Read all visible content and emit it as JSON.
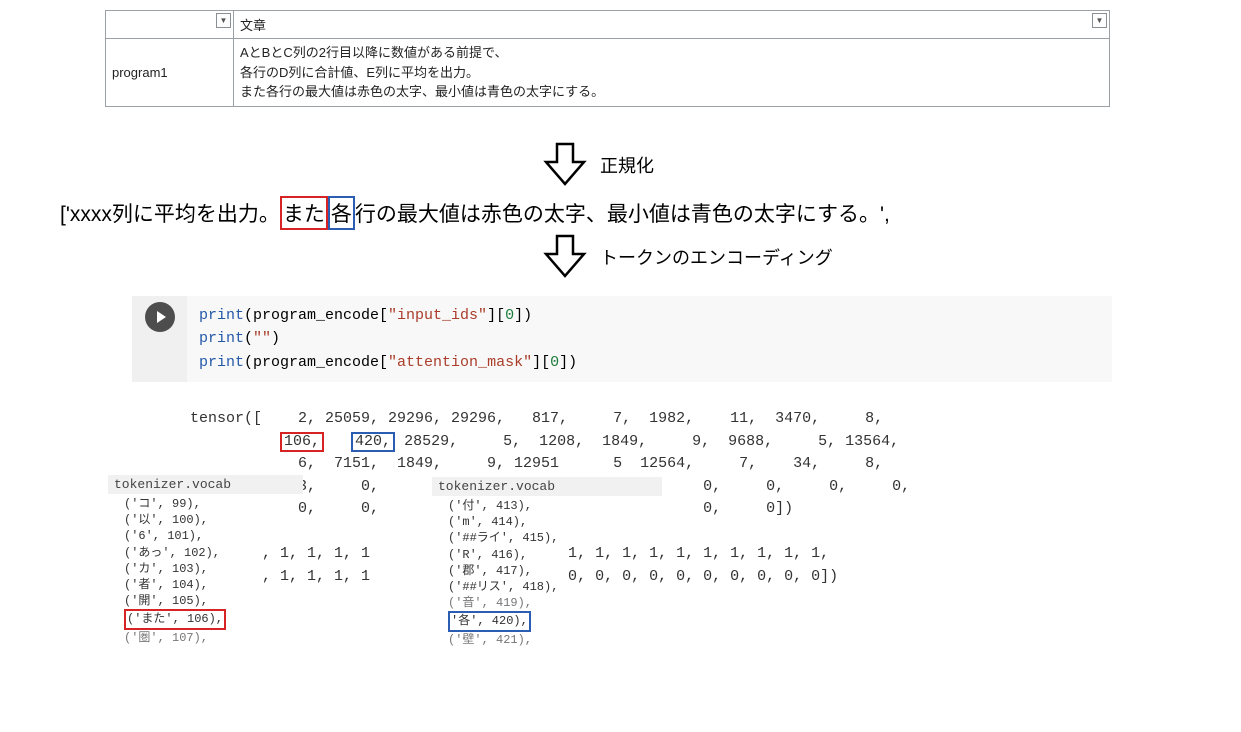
{
  "table": {
    "header_right": "文章",
    "row1_left": "program1",
    "row1_line1": "AとBとC列の2行目以降に数値がある前提で、",
    "row1_line2": "各行のD列に合計値、E列に平均を出力。",
    "row1_line3": "また各行の最大値は赤色の太字、最小値は青色の太字にする。"
  },
  "arrows": {
    "label1": "正規化",
    "label2": "トークンのエンコーディング"
  },
  "norm": {
    "prefix": "['xxxx列に平均を出力。",
    "red": "また",
    "blue": "各",
    "suffix": "行の最大値は赤色の太字、最小値は青色の太字にする。',"
  },
  "code": {
    "line1_a": "print",
    "line1_b": "(program_encode[",
    "line1_str": "\"input_ids\"",
    "line1_c": "][",
    "line1_num": "0",
    "line1_d": "])",
    "line2_a": "print",
    "line2_b": "(",
    "line2_str": "\"\"",
    "line2_c": ")",
    "line3_a": "print",
    "line3_b": "(program_encode[",
    "line3_str": "\"attention_mask\"",
    "line3_c": "][",
    "line3_num": "0",
    "line3_d": "])"
  },
  "tensor": {
    "r1": "tensor([    2, 25059, 29296, 29296,   817,     7,  1982,    11,  3470,     8,",
    "r2_pre": "          ",
    "r2_red": "106,",
    "r2_mid": "   ",
    "r2_blue": "420,",
    "r2_post": " 28529,     5,  1208,  1849,     9,  9688,     5, 13564,",
    "r3": "            6,  7151,  1849,     9, 12951      5  12564,     7,    34,     8,",
    "r4": "            3,     0,                                    0,     0,     0,     0,",
    "r5": "            0,     0,                                    0,     0])",
    "r6": "",
    "r7": "        , 1, 1, 1, 1                      1, 1, 1, 1, 1, 1, 1, 1, 1, 1,",
    "r8": "        , 1, 1, 1, 1                      0, 0, 0, 0, 0, 0, 0, 0, 0, 0])"
  },
  "vocab_a": {
    "head": "tokenizer.vocab",
    "l1": "('コ', 99),",
    "l2": "('以', 100),",
    "l3": "('6', 101),",
    "l4": "('あっ', 102),",
    "l5": "('カ', 103),",
    "l6": "('者', 104),",
    "l7": "('開', 105),",
    "l8_red": "('また', 106),",
    "l9": "('圏', 107),"
  },
  "vocab_b": {
    "head": "tokenizer.vocab",
    "l1": "('付', 413),",
    "l2": "('m', 414),",
    "l3": "('##ライ', 415),",
    "l4": "('R', 416),",
    "l5": "('郡', 417),",
    "l6": "('##リス', 418),",
    "l7": "('音', 419),",
    "l8_blue": "'各', 420),",
    "l9": "('壁', 421),"
  }
}
